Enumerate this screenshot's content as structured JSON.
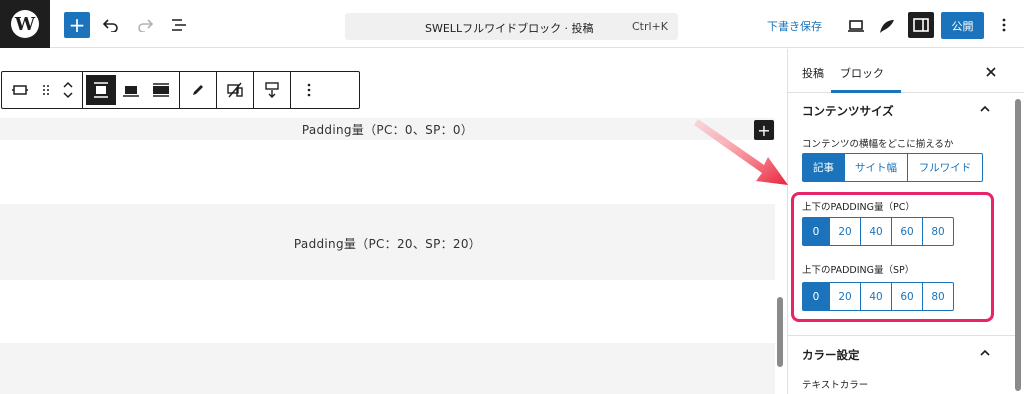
{
  "topbar": {
    "cmd_title": "SWELLフルワイドブロック · 投稿",
    "cmd_shortcut": "Ctrl+K",
    "draft_label": "下書き保存",
    "publish_label": "公開"
  },
  "canvas": {
    "label_1": "Padding量（PC：0、SP：0）",
    "label_2": "Padding量（PC：20、SP：20）"
  },
  "sidebar": {
    "tab_post": "投稿",
    "tab_block": "ブロック",
    "content_size": {
      "title": "コンテンツサイズ",
      "align_label": "コンテンツの横幅をどこに揃えるか",
      "align_options": [
        "記事",
        "サイト幅",
        "フルワイド"
      ],
      "align_selected": "記事"
    },
    "padding_pc": {
      "label": "上下のPADDING量（PC）",
      "options": [
        "0",
        "20",
        "40",
        "60",
        "80"
      ],
      "selected": "0"
    },
    "padding_sp": {
      "label": "上下のPADDING量（SP）",
      "options": [
        "0",
        "20",
        "40",
        "60",
        "80"
      ],
      "selected": "0"
    },
    "color_settings": {
      "title": "カラー設定",
      "text_color_label": "テキストカラー"
    }
  },
  "colors": {
    "accent": "#1b74bb",
    "highlight": "#e8236a",
    "dark": "#1e1e1e"
  },
  "icons": [
    "wordpress-logo",
    "plus-icon",
    "undo-icon",
    "redo-icon",
    "list-view-icon",
    "desktop-view-icon",
    "style-icon",
    "sidebar-toggle-icon",
    "more-vertical-icon",
    "close-icon",
    "chevron-up-icon"
  ]
}
